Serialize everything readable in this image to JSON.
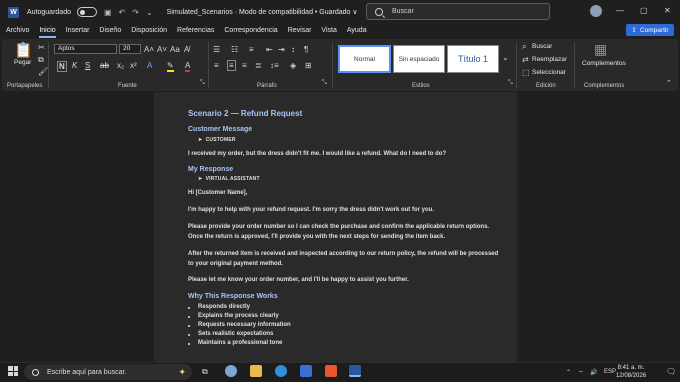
{
  "titlebar": {
    "app_letter": "W",
    "autosave_label": "Autoguardado",
    "document_title": "Simulated_Scenarios  ·  Modo de compatibilidad  •  Guardado  ∨",
    "search_placeholder": "Buscar"
  },
  "menu": {
    "items": [
      "Archivo",
      "Inicio",
      "Insertar",
      "Diseño",
      "Disposición",
      "Referencias",
      "Correspondencia",
      "Revisar",
      "Vista",
      "Ayuda"
    ],
    "active": "Inicio",
    "share_label": "Compartir"
  },
  "ribbon": {
    "paste_label": "Pegar",
    "font_name": "Aptos",
    "font_size": "20",
    "styles": [
      "Normal",
      "Sin espaciado",
      "Título 1"
    ],
    "find_label": "Buscar",
    "replace_label": "Reemplazar",
    "select_label": "Seleccionar",
    "addins_label": "Complementos",
    "groups": {
      "clipboard": "Portapapeles",
      "font": "Fuente",
      "paragraph": "Párrafo",
      "styles": "Estilos",
      "editing": "Edición",
      "addins": "Complementos"
    },
    "accent": "#2f6bd6"
  },
  "document": {
    "heading": "Scenario 2 — Refund Request",
    "customer_message_heading": "Customer Message",
    "customer_label": "CUSTOMER",
    "customer_text": "I received my order, but the dress didn't fit me. I would like a refund. What do I need to do?",
    "response_heading": "My Response",
    "assistant_label": "VIRTUAL ASSISTANT",
    "greeting": "Hi [Customer Name],",
    "para1": "I'm happy to help with your refund request. I'm sorry the dress didn't work out for you.",
    "para2_line1": "Please provide your order number so I can check the purchase and confirm the applicable return options.",
    "para2_line2": "Once the return is approved, I'll provide you with the next steps for sending the item back.",
    "para3_line1": "After the returned item is received and inspected according to our return policy, the refund will be processed",
    "para3_line2": "to your original payment method.",
    "para4": "Please let me know your order number, and I'll be happy to assist you further.",
    "why_heading": "Why This Response Works",
    "bullets": [
      "Responds directly",
      "Explains the process clearly",
      "Requests necessary information",
      "Sets realistic expectations",
      "Maintains a professional tone"
    ]
  },
  "taskbar": {
    "search_placeholder": "Escribe aquí para buscar.",
    "language": "ESP",
    "time": "8:41 a. m.",
    "date": "12/08/2026"
  }
}
